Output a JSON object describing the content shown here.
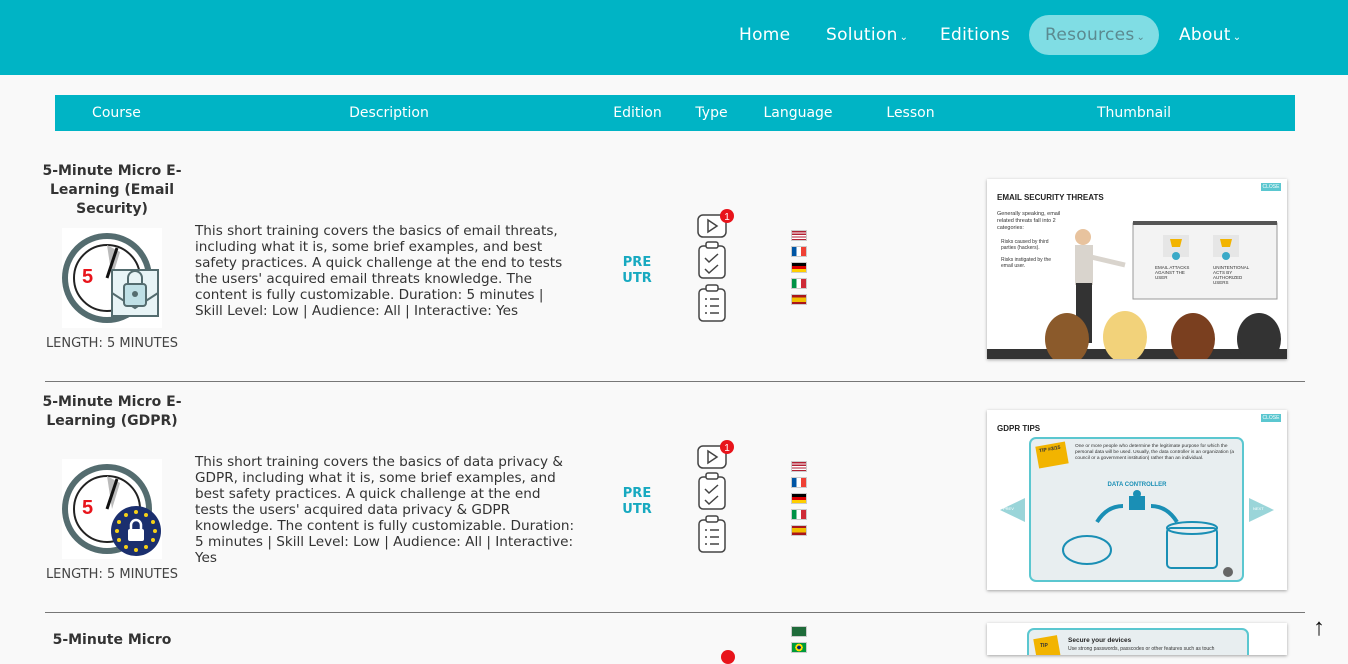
{
  "nav": {
    "home": "Home",
    "solution": "Solution",
    "editions": "Editions",
    "resources": "Resources",
    "about": "About",
    "chevron": "⌄"
  },
  "table": {
    "headers": {
      "course": "Course",
      "description": "Description",
      "edition": "Edition",
      "type": "Type",
      "language": "Language",
      "lesson": "Lesson",
      "thumbnail": "Thumbnail"
    },
    "rows": [
      {
        "title": "5-Minute Micro E-Learning (Email Security)",
        "length": "LENGTH: 5 MINUTES",
        "image_icon": "stopwatch-envelope-lock-icon",
        "description": "This short training covers the basics of email threats, including what it is, some brief examples, and best safety practices. A quick challenge at the end to tests the users' acquired email threats knowledge. The content is fully customizable. Duration: 5 minutes | Skill Level: Low | Audience: All | Interactive: Yes",
        "edition": [
          "PRE",
          "UTR"
        ],
        "type_badge": "1",
        "languages": [
          "us",
          "fr",
          "de",
          "it",
          "es"
        ],
        "thumbnail": {
          "title": "EMAIL SECURITY THREATS",
          "close": "CLOSE",
          "text": "Generally speaking, email related threats fall into 2 categories:",
          "bullets": [
            "Risks caused by third parties (hackers).",
            "Risks instigated by the email user."
          ],
          "box1": "EMAIL ATTACKS AGAINST THE USER",
          "box2": "UNINTENTIONAL ACTS BY AUTHORIZED USERS"
        }
      },
      {
        "title": "5-Minute Micro E-Learning (GDPR)",
        "length": "LENGTH: 5 MINUTES",
        "image_icon": "stopwatch-eu-lock-icon",
        "description": "This short training covers the basics of data privacy & GDPR, including what it is, some brief examples, and best safety practices. A quick challenge at the end tests the users' acquired data privacy & GDPR knowledge. The content is fully customizable. Duration: 5 minutes | Skill Level: Low | Audience: All | Interactive: Yes",
        "edition": [
          "PRE",
          "UTR"
        ],
        "type_badge": "1",
        "languages": [
          "us",
          "fr",
          "de",
          "it",
          "es"
        ],
        "thumbnail": {
          "title": "GDPR TIPS",
          "close": "CLOSE",
          "tip": "TIP #3/15",
          "text": "One or more people who determine the legitimate purpose for which the personal data will be used. Usually, the data controller is an organization (a council or a government institution) rather than an individual.",
          "label": "DATA CONTROLLER",
          "prev": "PREV",
          "next": "NEXT"
        }
      },
      {
        "title": "5-Minute Micro",
        "languages": [
          "sa",
          "br"
        ],
        "thumbnail": {
          "tip": "TIP",
          "title": "Secure your devices",
          "text": "Use strong passwords, passcodes or other features such as touch"
        }
      }
    ]
  },
  "scroll_top": "↑",
  "colors": {
    "brand": "#00b4c5",
    "edition": "#17a9c0",
    "badge": "#e8141b"
  }
}
